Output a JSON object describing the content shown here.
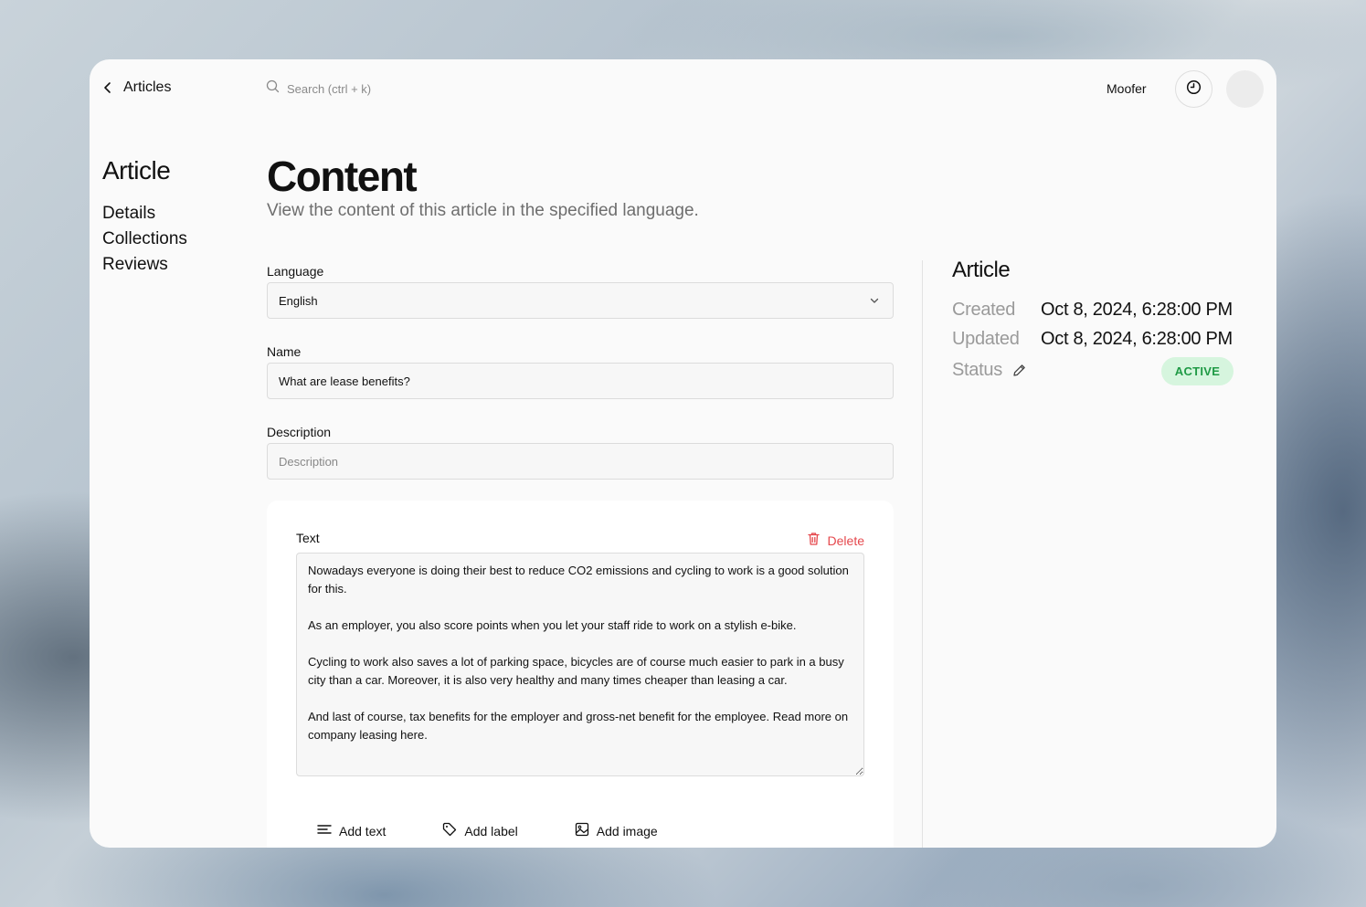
{
  "topbar": {
    "back_label": "Articles",
    "search_placeholder": "Search (ctrl + k)",
    "user_name": "Moofer"
  },
  "sidebar": {
    "title": "Article",
    "items": [
      {
        "label": "Details"
      },
      {
        "label": "Collections"
      },
      {
        "label": "Reviews"
      }
    ]
  },
  "header": {
    "title": "Content",
    "subtitle": "View the content of this article in the specified language."
  },
  "form": {
    "language": {
      "label": "Language",
      "value": "English"
    },
    "name": {
      "label": "Name",
      "value": "What are lease benefits?"
    },
    "description": {
      "label": "Description",
      "value": "",
      "placeholder": "Description"
    },
    "text_block": {
      "label": "Text",
      "delete_label": "Delete",
      "value": "Nowadays everyone is doing their best to reduce CO2 emissions and cycling to work is a good solution for this.\n\nAs an employer, you also score points when you let your staff ride to work on a stylish e-bike.\n\nCycling to work also saves a lot of parking space, bicycles are of course much easier to park in a busy city than a car. Moreover, it is also very healthy and many times cheaper than leasing a car.\n\nAnd last of course, tax benefits for the employer and gross-net benefit for the employee. Read more on company leasing here."
    },
    "actions": [
      {
        "label": "Add text",
        "icon": "text-lines-icon"
      },
      {
        "label": "Add label",
        "icon": "tag-icon"
      },
      {
        "label": "Add image",
        "icon": "image-icon"
      }
    ]
  },
  "details_panel": {
    "title": "Article",
    "created": {
      "key": "Created",
      "value": "Oct 8, 2024, 6:28:00 PM"
    },
    "updated": {
      "key": "Updated",
      "value": "Oct 8, 2024, 6:28:00 PM"
    },
    "status": {
      "key": "Status",
      "value": "ACTIVE"
    }
  },
  "colors": {
    "danger": "#e5484d",
    "status_bg": "#d6f5de",
    "status_fg": "#1f9a45"
  }
}
